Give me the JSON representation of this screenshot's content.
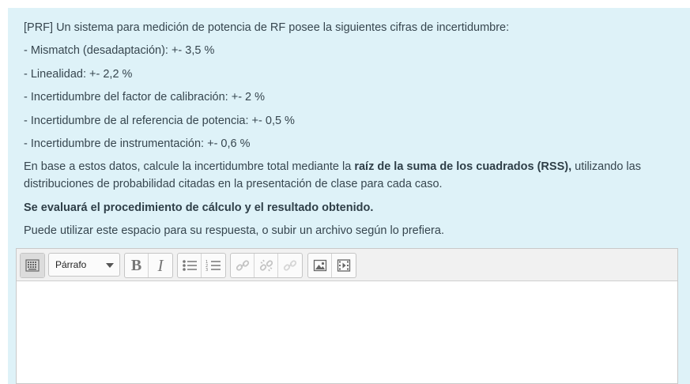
{
  "question": {
    "intro": "[PRF] Un sistema para medición de potencia de RF posee la siguientes cifras de incertidumbre:",
    "items": [
      "- Mismatch (desadaptación): +- 3,5 %",
      "- Linealidad: +- 2,2 %",
      "- Incertidumbre del factor de calibración: +- 2 %",
      "- Incertidumbre de al referencia de potencia: +- 0,5 %",
      "- Incertidumbre de instrumentación: +- 0,6 %"
    ],
    "instruction_pre": "En base a estos datos, calcule la incertidumbre total mediante la ",
    "instruction_bold": "raíz de la suma de los cuadrados (RSS),",
    "instruction_post": " utilizando las distribuciones de probabilidad citadas en la presentación de clase para cada caso.",
    "evaluation": "Se evaluará el procedimiento de cálculo y el resultado obtenido.",
    "hint": "Puede utilizar este espacio para su respuesta, o subir un archivo según lo prefiera."
  },
  "editor": {
    "format_select": "Párrafo",
    "bold_label": "B",
    "italic_label": "I",
    "toolbar_icons": [
      "toolbar-toggle-icon",
      "bullet-list-icon",
      "numbered-list-icon",
      "link-icon",
      "unlink-icon",
      "anchor-icon",
      "image-icon",
      "media-icon"
    ],
    "content": ""
  }
}
